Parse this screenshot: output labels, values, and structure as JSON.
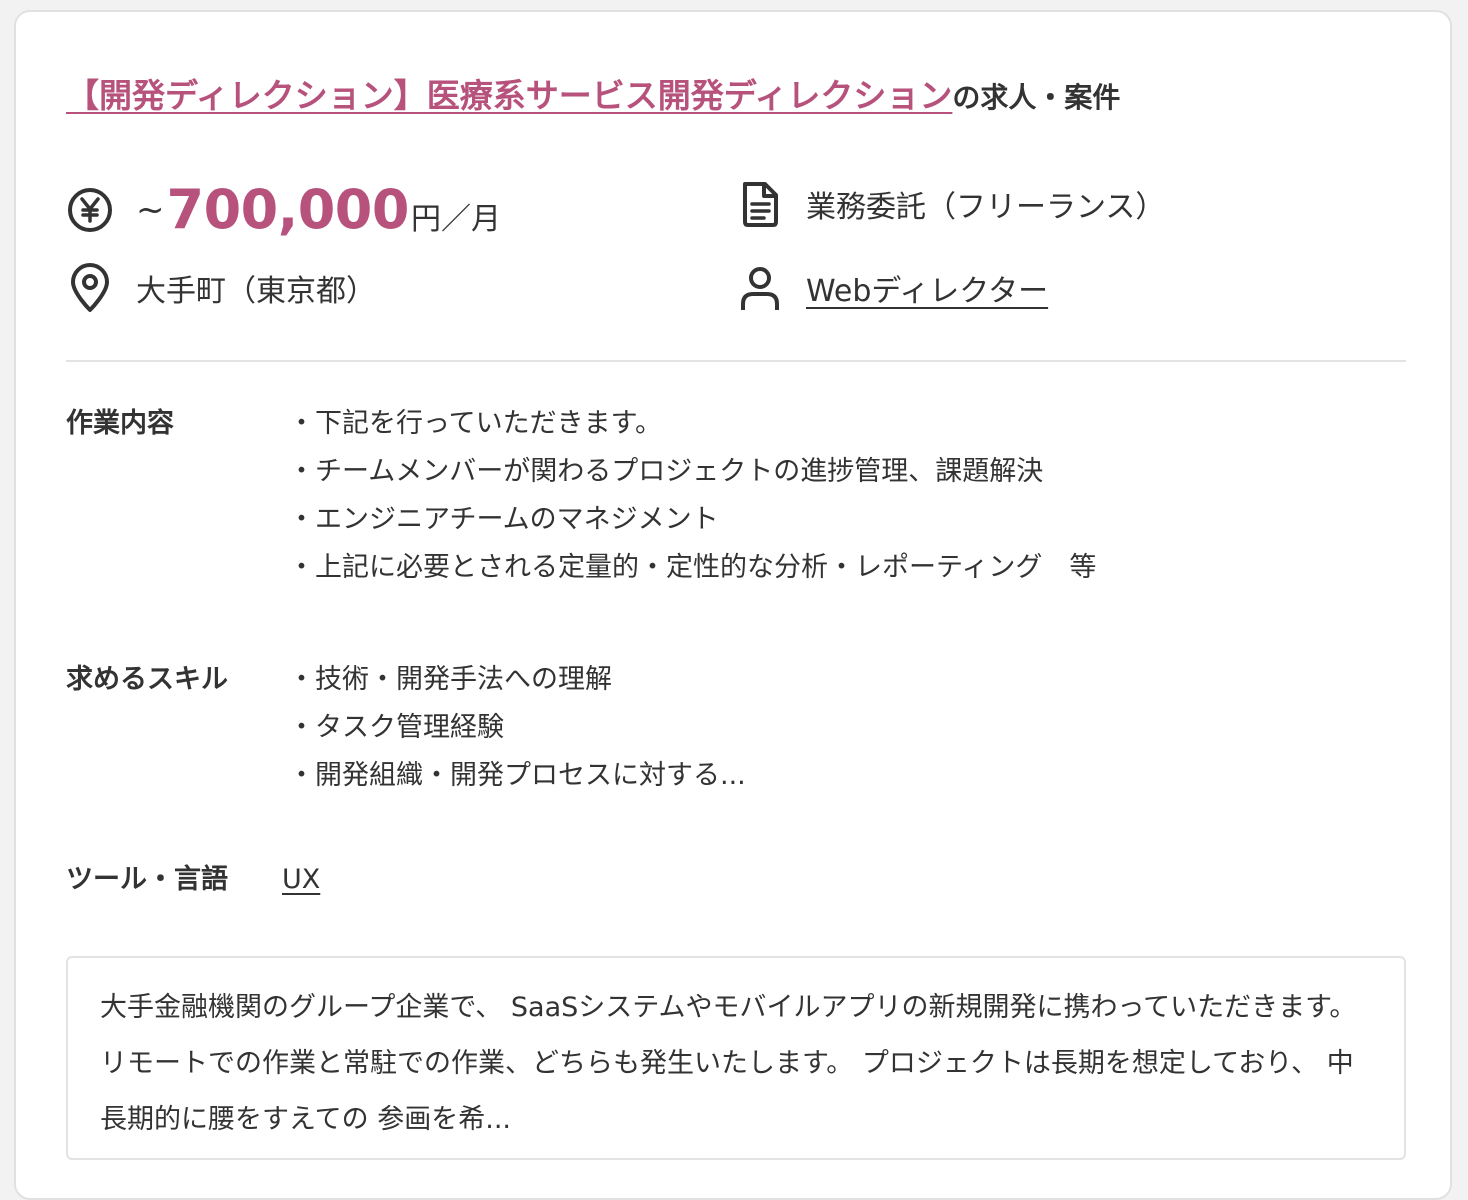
{
  "job": {
    "title_link": "【開発ディレクション】医療系サービス開発ディレクション",
    "title_suffix": "の求人・案件",
    "salary": {
      "prefix": "~",
      "amount": "700,000",
      "unit": "円／月"
    },
    "contract_type": "業務委託（フリーランス）",
    "location": "大手町（東京都）",
    "role": "Webディレクター",
    "work_label": "作業内容",
    "work_items": [
      "・下記を行っていただきます。",
      "・チームメンバーが関わるプロジェクトの進捗管理、課題解決",
      "・エンジニアチームのマネジメント",
      "・上記に必要とされる定量的・定性的な分析・レポーティング　等"
    ],
    "skills_label": "求めるスキル",
    "skills_items": [
      "・技術・開発手法への理解",
      "・タスク管理経験",
      "・開発組織・開発プロセスに対する..."
    ],
    "tools_label": "ツール・言語",
    "tools_value": "UX",
    "description": "大手金融機関のグループ企業で、 SaaSシステムやモバイルアプリの新規開発に携わっていただきます。 リモートでの作業と常駐での作業、どちらも発生いたします。 プロジェクトは長期を想定しており、 中長期的に腰をすえての 参画を希..."
  },
  "colors": {
    "accent": "#b6527b",
    "text": "#333333",
    "border": "#e3e3e3"
  },
  "icons": {
    "salary": "yen-circle-icon",
    "contract": "document-icon",
    "location": "map-pin-icon",
    "role": "person-icon"
  }
}
